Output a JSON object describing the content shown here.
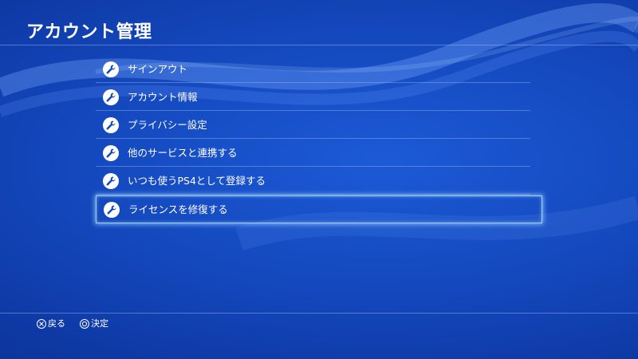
{
  "header": {
    "title": "アカウント管理"
  },
  "menu": {
    "items": [
      {
        "label": "サインアウト",
        "icon": "wrench-icon",
        "selected": false
      },
      {
        "label": "アカウント情報",
        "icon": "wrench-icon",
        "selected": false
      },
      {
        "label": "プライバシー設定",
        "icon": "wrench-icon",
        "selected": false
      },
      {
        "label": "他のサービスと連携する",
        "icon": "wrench-icon",
        "selected": false
      },
      {
        "label": "いつも使うPS4として登録する",
        "icon": "wrench-icon",
        "selected": false
      },
      {
        "label": "ライセンスを修復する",
        "icon": "wrench-icon",
        "selected": true
      }
    ]
  },
  "footer": {
    "back": {
      "icon": "cross-button-icon",
      "label": "戻る"
    },
    "confirm": {
      "icon": "circle-button-icon",
      "label": "決定"
    }
  },
  "colors": {
    "background": "#1448bd",
    "selection_glow": "#a8ccff",
    "text": "#ffffff"
  }
}
